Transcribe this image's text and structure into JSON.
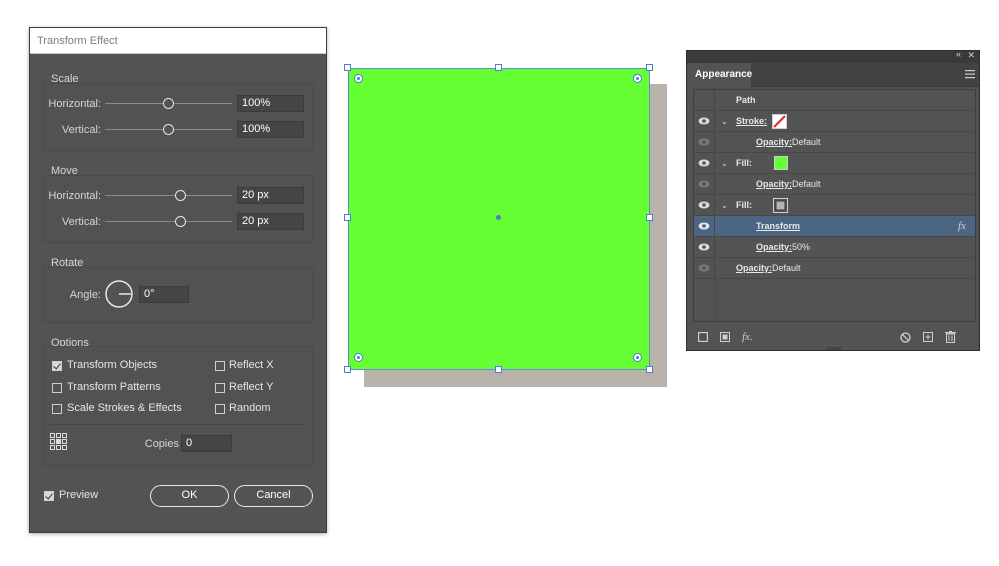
{
  "dialog": {
    "title": "Transform Effect",
    "scale": {
      "label": "Scale",
      "horizontal_label": "Horizontal:",
      "horizontal_value": "100%",
      "vertical_label": "Vertical:",
      "vertical_value": "100%"
    },
    "move": {
      "label": "Move",
      "horizontal_label": "Horizontal:",
      "horizontal_value": "20 px",
      "vertical_label": "Vertical:",
      "vertical_value": "20 px"
    },
    "rotate": {
      "label": "Rotate",
      "angle_label": "Angle:",
      "angle_value": "0°"
    },
    "options": {
      "label": "Options",
      "transform_objects": {
        "label": "Transform Objects",
        "checked": true
      },
      "transform_patterns": {
        "label": "Transform Patterns",
        "checked": false
      },
      "scale_strokes": {
        "label": "Scale Strokes & Effects",
        "checked": false
      },
      "reflect_x": {
        "label": "Reflect X",
        "checked": false
      },
      "reflect_y": {
        "label": "Reflect Y",
        "checked": false
      },
      "random": {
        "label": "Random",
        "checked": false
      },
      "copies_label": "Copies",
      "copies_value": "0"
    },
    "preview": {
      "label": "Preview",
      "checked": true
    },
    "ok_label": "OK",
    "cancel_label": "Cancel"
  },
  "canvas": {
    "fill_color": "#66ff33",
    "shadow_color": "#b8b2ab",
    "selection_color": "#4a7fd0"
  },
  "appearance": {
    "tab_label": "Appearance",
    "rows": [
      {
        "label": "Path"
      },
      {
        "label": "Stroke:"
      },
      {
        "label": "Opacity:",
        "value": "Default"
      },
      {
        "label": "Fill:"
      },
      {
        "label": "Opacity:",
        "value": "Default"
      },
      {
        "label": "Fill:"
      },
      {
        "label": "Transform",
        "fx": "fx"
      },
      {
        "label": "Opacity:",
        "value": "50%"
      },
      {
        "label": "Opacity:",
        "value": "Default"
      }
    ],
    "fx_button": "fx."
  }
}
